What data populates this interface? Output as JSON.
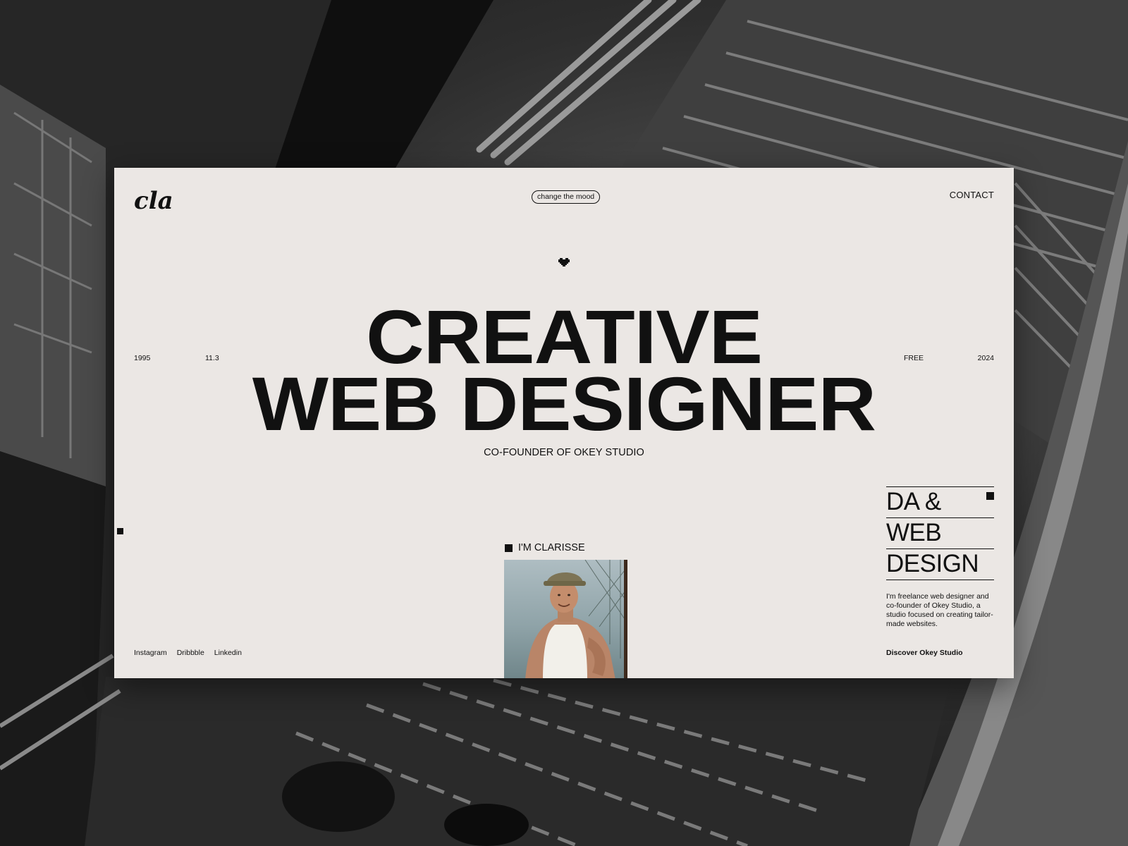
{
  "site": {
    "logo_text": "cla",
    "mood_button": "change the mood",
    "contact_link": "CONTACT"
  },
  "hero": {
    "meta_left": [
      "1995",
      "11.3"
    ],
    "meta_right": [
      "FREE",
      "2024"
    ],
    "headline_line1": "CREATIVE",
    "headline_line2": "WEB DESIGNER",
    "subheadline": "CO-FOUNDER OF OKEY STUDIO"
  },
  "intro": {
    "label": "I'M CLARISSE"
  },
  "discipline": {
    "rows": [
      "DA &",
      "WEB",
      "DESIGN"
    ]
  },
  "bio": {
    "text": "I'm freelance web designer and co-founder of Okey Studio, a studio focused on creating tailor-made websites.",
    "cta": "Discover Okey Studio"
  },
  "socials": [
    "Instagram",
    "Dribbble",
    "Linkedin"
  ],
  "colors": {
    "card_background": "#ebe7e4",
    "ink": "#111111",
    "backdrop": "#1d1d1d"
  },
  "icons": {
    "heart": "pixel-heart-icon",
    "square": "square-bullet-icon"
  }
}
